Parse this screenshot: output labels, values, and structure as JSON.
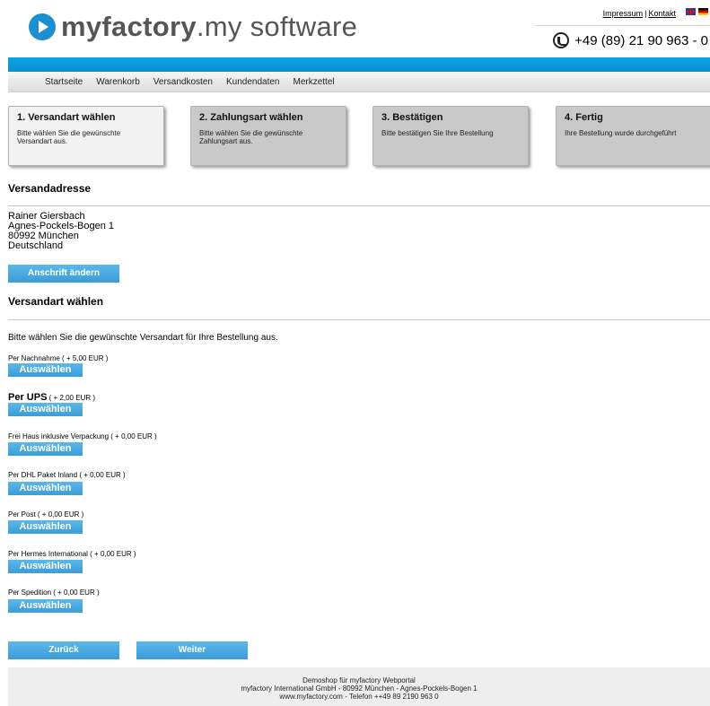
{
  "header": {
    "logo_bold": "myfactory",
    "logo_rest": ".my software",
    "links": [
      "Impressum",
      "Kontakt"
    ],
    "link_sep": "|",
    "phone": "+49 (89) 21 90 963 - 0"
  },
  "nav": [
    "Startseite",
    "Warenkorb",
    "Versandkosten",
    "Kundendaten",
    "Merkzettel"
  ],
  "steps": [
    {
      "title": "1. Versandart wählen",
      "desc": "Bitte wählen Sie die gewünschte Versandart aus."
    },
    {
      "title": "2. Zahlungsart wählen",
      "desc": "Bitte wählen Sie die gewünschte Zahlungsart aus."
    },
    {
      "title": "3. Bestätigen",
      "desc": "Bitte bestätigen Sie Ihre Bestellung"
    },
    {
      "title": "4. Fertig",
      "desc": "Ihre Bestellung wurde durchgeführt"
    }
  ],
  "address_section": {
    "heading": "Versandadresse",
    "lines": [
      "Rainer Giersbach",
      "Agnes-Pockels-Bogen 1",
      "80992 München",
      "Deutschland"
    ],
    "change_button": "Anschrift ändern"
  },
  "shipping_section": {
    "heading": "Versandart wählen",
    "intro": "Bitte wählen Sie die gewünschte Versandart für Ihre Bestellung aus.",
    "select_label": "Auswählen",
    "options": [
      {
        "name": "Per Nachnahme",
        "price": "( + 5,00 EUR )"
      },
      {
        "name": "Per UPS",
        "price": "( + 2,00 EUR )"
      },
      {
        "name": "Frei Haus inklusive Verpackung",
        "price": "( + 0,00 EUR )"
      },
      {
        "name": "Per DHL Paket Inland",
        "price": "( + 0,00 EUR )"
      },
      {
        "name": "Per Post",
        "price": "( + 0,00 EUR )"
      },
      {
        "name": "Per Hermes International",
        "price": "( + 0,00 EUR )"
      },
      {
        "name": "Per Spedition",
        "price": "( + 0,00 EUR )"
      }
    ]
  },
  "actions": {
    "back": "Zurück",
    "next": "Weiter"
  },
  "footer": {
    "line1": "Demoshop für myfactory Webportal",
    "line2": "myfactory International GmbH - 80992 München - Agnes-Pockels-Bogen 1",
    "line3": "www.myfactory.com - Telefon ++49 89 2190 963 0"
  },
  "colors": {
    "accent": "#1c8fd1",
    "button": "#3a9dd8",
    "bar": "#0aa5e8"
  }
}
